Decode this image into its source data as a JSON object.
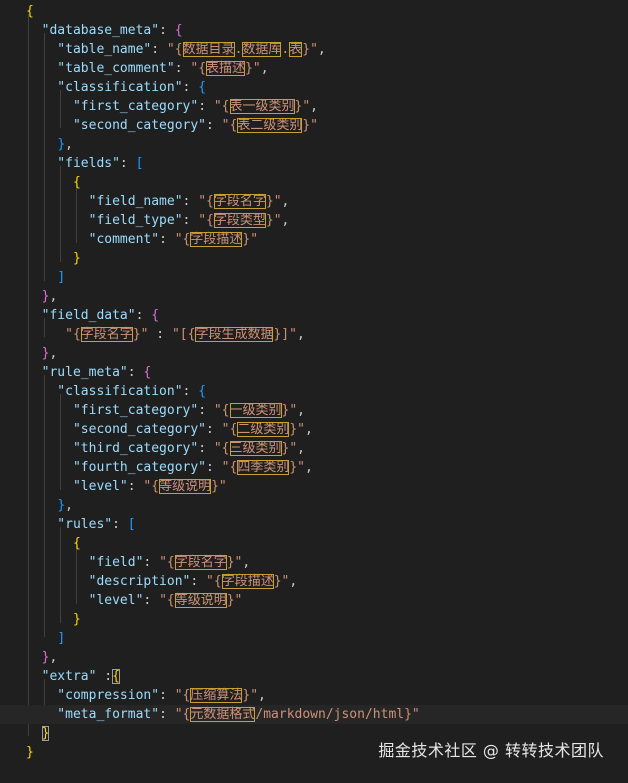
{
  "code": {
    "lines": [
      [
        [
          "b1",
          "{"
        ]
      ],
      [
        [
          "k",
          "  \"database_meta\""
        ],
        [
          "p",
          ": "
        ],
        [
          "b2",
          "{"
        ]
      ],
      [
        [
          "k",
          "    \"table_name\""
        ],
        [
          "p",
          ": "
        ],
        [
          "s",
          "\"{"
        ],
        [
          "hl",
          "数据目录"
        ],
        [
          "s",
          "."
        ],
        [
          "hl",
          "数据库"
        ],
        [
          "s",
          "."
        ],
        [
          "hl",
          "表"
        ],
        [
          "s",
          "}\""
        ],
        [
          "p",
          ","
        ]
      ],
      [
        [
          "k",
          "    \"table_comment\""
        ],
        [
          "p",
          ": "
        ],
        [
          "s",
          "\"{"
        ],
        [
          "hl",
          "表描述"
        ],
        [
          "s",
          "}\""
        ],
        [
          "p",
          ","
        ]
      ],
      [
        [
          "k",
          "    \"classification\""
        ],
        [
          "p",
          ": "
        ],
        [
          "b3",
          "{"
        ]
      ],
      [
        [
          "k",
          "      \"first_category\""
        ],
        [
          "p",
          ": "
        ],
        [
          "s",
          "\"{"
        ],
        [
          "hl",
          "表一级类别"
        ],
        [
          "s",
          "}\""
        ],
        [
          "p",
          ","
        ]
      ],
      [
        [
          "k",
          "      \"second_category\""
        ],
        [
          "p",
          ": "
        ],
        [
          "s",
          "\"{"
        ],
        [
          "hl",
          "表二级类别"
        ],
        [
          "s",
          "}\""
        ]
      ],
      [
        [
          "p",
          "    "
        ],
        [
          "b3",
          "}"
        ],
        [
          "p",
          ","
        ]
      ],
      [
        [
          "k",
          "    \"fields\""
        ],
        [
          "p",
          ": "
        ],
        [
          "b3",
          "["
        ]
      ],
      [
        [
          "p",
          "      "
        ],
        [
          "b1",
          "{"
        ]
      ],
      [
        [
          "k",
          "        \"field_name\""
        ],
        [
          "p",
          ": "
        ],
        [
          "s",
          "\"{"
        ],
        [
          "hl",
          "字段名字"
        ],
        [
          "s",
          "}\""
        ],
        [
          "p",
          ","
        ]
      ],
      [
        [
          "k",
          "        \"field_type\""
        ],
        [
          "p",
          ": "
        ],
        [
          "s",
          "\"{"
        ],
        [
          "hl",
          "字段类型"
        ],
        [
          "s",
          "}\""
        ],
        [
          "p",
          ","
        ]
      ],
      [
        [
          "k",
          "        \"comment\""
        ],
        [
          "p",
          ": "
        ],
        [
          "s",
          "\"{"
        ],
        [
          "hl",
          "字段描述"
        ],
        [
          "s",
          "}\""
        ]
      ],
      [
        [
          "p",
          "      "
        ],
        [
          "b1",
          "}"
        ]
      ],
      [
        [
          "p",
          "    "
        ],
        [
          "b3",
          "]"
        ]
      ],
      [
        [
          "p",
          "  "
        ],
        [
          "b2",
          "}"
        ],
        [
          "p",
          ","
        ]
      ],
      [
        [
          "k",
          "  \"field_data\""
        ],
        [
          "p",
          ": "
        ],
        [
          "b2",
          "{"
        ]
      ],
      [
        [
          "s",
          "     \"{"
        ],
        [
          "hl",
          "字段名字"
        ],
        [
          "s",
          "}\""
        ],
        [
          "p",
          " : "
        ],
        [
          "s",
          "\"[{"
        ],
        [
          "hl",
          "字段生成数据"
        ],
        [
          "s",
          "}]\""
        ],
        [
          "p",
          ","
        ]
      ],
      [
        [
          "p",
          "  "
        ],
        [
          "b2",
          "}"
        ],
        [
          "p",
          ","
        ]
      ],
      [
        [
          "k",
          "  \"rule_meta\""
        ],
        [
          "p",
          ": "
        ],
        [
          "b2",
          "{"
        ]
      ],
      [
        [
          "k",
          "    \"classification\""
        ],
        [
          "p",
          ": "
        ],
        [
          "b3",
          "{"
        ]
      ],
      [
        [
          "k",
          "      \"first_category\""
        ],
        [
          "p",
          ": "
        ],
        [
          "s",
          "\"{"
        ],
        [
          "hl",
          "一级类别"
        ],
        [
          "s",
          "}\""
        ],
        [
          "p",
          ","
        ]
      ],
      [
        [
          "k",
          "      \"second_category\""
        ],
        [
          "p",
          ": "
        ],
        [
          "s",
          "\"{"
        ],
        [
          "hl",
          "二级类别"
        ],
        [
          "s",
          "}\""
        ],
        [
          "p",
          ","
        ]
      ],
      [
        [
          "k",
          "      \"third_category\""
        ],
        [
          "p",
          ": "
        ],
        [
          "s",
          "\"{"
        ],
        [
          "hl",
          "三级类别"
        ],
        [
          "s",
          "}\""
        ],
        [
          "p",
          ","
        ]
      ],
      [
        [
          "k",
          "      \"fourth_category\""
        ],
        [
          "p",
          ": "
        ],
        [
          "s",
          "\"{"
        ],
        [
          "hl",
          "四季类别"
        ],
        [
          "s",
          "}\""
        ],
        [
          "p",
          ","
        ]
      ],
      [
        [
          "k",
          "      \"level\""
        ],
        [
          "p",
          ": "
        ],
        [
          "s",
          "\"{"
        ],
        [
          "hl",
          "等级说明"
        ],
        [
          "s",
          "}\""
        ]
      ],
      [
        [
          "p",
          "    "
        ],
        [
          "b3",
          "}"
        ],
        [
          "p",
          ","
        ]
      ],
      [
        [
          "k",
          "    \"rules\""
        ],
        [
          "p",
          ": "
        ],
        [
          "b3",
          "["
        ]
      ],
      [
        [
          "p",
          "      "
        ],
        [
          "b1",
          "{"
        ]
      ],
      [
        [
          "k",
          "        \"field\""
        ],
        [
          "p",
          ": "
        ],
        [
          "s",
          "\"{"
        ],
        [
          "hl",
          "字段名字"
        ],
        [
          "s",
          "}\""
        ],
        [
          "p",
          ","
        ]
      ],
      [
        [
          "k",
          "        \"description\""
        ],
        [
          "p",
          ": "
        ],
        [
          "s",
          "\"{"
        ],
        [
          "hl",
          "字段描述"
        ],
        [
          "s",
          "}\""
        ],
        [
          "p",
          ","
        ]
      ],
      [
        [
          "k",
          "        \"level\""
        ],
        [
          "p",
          ": "
        ],
        [
          "s",
          "\"{"
        ],
        [
          "hl",
          "等级说明"
        ],
        [
          "s",
          "}\""
        ]
      ],
      [
        [
          "p",
          "      "
        ],
        [
          "b1",
          "}"
        ]
      ],
      [
        [
          "p",
          "    "
        ],
        [
          "b3",
          "]"
        ]
      ],
      [
        [
          "p",
          "  "
        ],
        [
          "b2",
          "}"
        ],
        [
          "p",
          ","
        ]
      ],
      [
        [
          "k",
          "  \"extra\""
        ],
        [
          "p",
          " :"
        ],
        [
          "hlb",
          "{"
        ]
      ],
      [
        [
          "k",
          "    \"compression\""
        ],
        [
          "p",
          ": "
        ],
        [
          "s",
          "\"{"
        ],
        [
          "hl",
          "压缩算法"
        ],
        [
          "s",
          "}\""
        ],
        [
          "p",
          ","
        ]
      ],
      [
        [
          "k",
          "    \"meta_format\""
        ],
        [
          "p",
          ": "
        ],
        [
          "s",
          "\"{"
        ],
        [
          "hl",
          "元数据格式"
        ],
        [
          "s",
          "/markdown/json/html}\""
        ]
      ],
      [
        [
          "p",
          "  "
        ],
        [
          "hlb",
          "}"
        ]
      ],
      [
        [
          "b1",
          "}"
        ]
      ]
    ]
  },
  "watermark": {
    "text": "掘金技术社区 @ 转转技术团队"
  },
  "colors": {
    "background": "#1f1f1f",
    "key": "#9cdcfe",
    "string": "#ce9178",
    "bracket_level1": "#ffd700",
    "bracket_level2": "#da70d6",
    "bracket_level3": "#179fff",
    "highlight_border": "#c8a030"
  }
}
